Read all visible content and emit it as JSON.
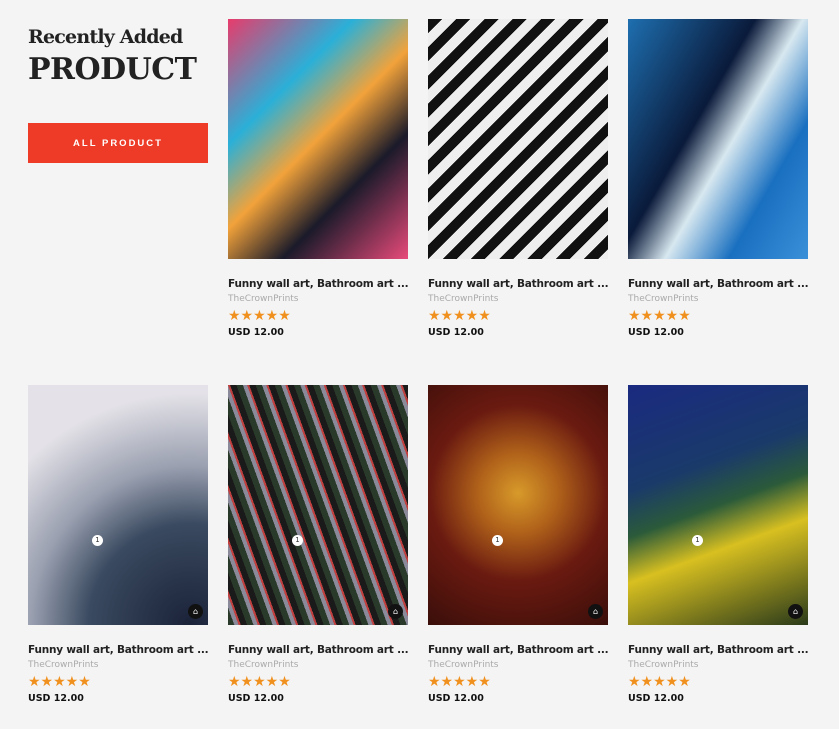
{
  "header": {
    "line1": "Recently Added",
    "line2": "PRODUCT",
    "button": "ALL PRODUCT"
  },
  "colors": {
    "accent": "#ee3b27",
    "star": "#f0901e"
  },
  "products": [
    {
      "title": "Funny wall art, Bathroom art ...",
      "brand": "TheCrownPrints",
      "rating": 5,
      "stars": "★★★★★",
      "price": "USD 12.00",
      "bg": "linear-gradient(135deg,#e83b6b 0%,#2ab0d8 30%,#f2a23a 50%,#1a1a2a 70%,#e84a7a 100%)"
    },
    {
      "title": "Funny wall art, Bathroom art ...",
      "brand": "TheCrownPrints",
      "rating": 5,
      "stars": "★★★★★",
      "price": "USD 12.00",
      "bg": "repeating-linear-gradient(135deg,#111 0 10px,#eee 10px 20px),linear-gradient(#2a9ad8,#e84a5a)"
    },
    {
      "title": "Funny wall art, Bathroom art ...",
      "brand": "TheCrownPrints",
      "rating": 5,
      "stars": "★★★★★",
      "price": "USD 12.00",
      "bg": "linear-gradient(120deg,#1e6fb0 0%,#0a1a3a 40%,#d8e8f0 55%,#1a70c0 75%,#3a90d8 100%)"
    },
    {
      "title": "Funny wall art, Bathroom art ...",
      "brand": "TheCrownPrints",
      "rating": 5,
      "stars": "★★★★★",
      "price": "USD 12.00",
      "bg": "radial-gradient(circle at 90% 100%,#1a2238 0%,#3a4a60 35%,#9aa0b0 55%,#e4e2e8 80%)",
      "badge": "1",
      "bag": "bag-icon"
    },
    {
      "title": "Funny wall art, Bathroom art ...",
      "brand": "TheCrownPrints",
      "rating": 5,
      "stars": "★★★★★",
      "price": "USD 12.00",
      "bg": "repeating-linear-gradient(70deg,#2a3a2a 0 6px,#8a8a9a 6px 10px,#c04040 10px 12px,#1a1a1a 12px 18px)",
      "badge": "1",
      "bag": "bag-icon"
    },
    {
      "title": "Funny wall art, Bathroom art ...",
      "brand": "TheCrownPrints",
      "rating": 5,
      "stars": "★★★★★",
      "price": "USD 12.00",
      "bg": "radial-gradient(circle at 50% 45%,#d89a2a 0%,#b0621a 25%,#6a1a10 55%,#3a0e0a 100%)",
      "badge": "1",
      "bag": "bag-icon"
    },
    {
      "title": "Funny wall art, Bathroom art ...",
      "brand": "TheCrownPrints",
      "rating": 5,
      "stars": "★★★★★",
      "price": "USD 12.00",
      "bg": "linear-gradient(160deg,#1a2a80 0%,#1a3a6a 35%,#2a5a3a 50%,#d8c020 65%,#2a3a1a 100%)",
      "badge": "1",
      "bag": "bag-icon"
    }
  ]
}
